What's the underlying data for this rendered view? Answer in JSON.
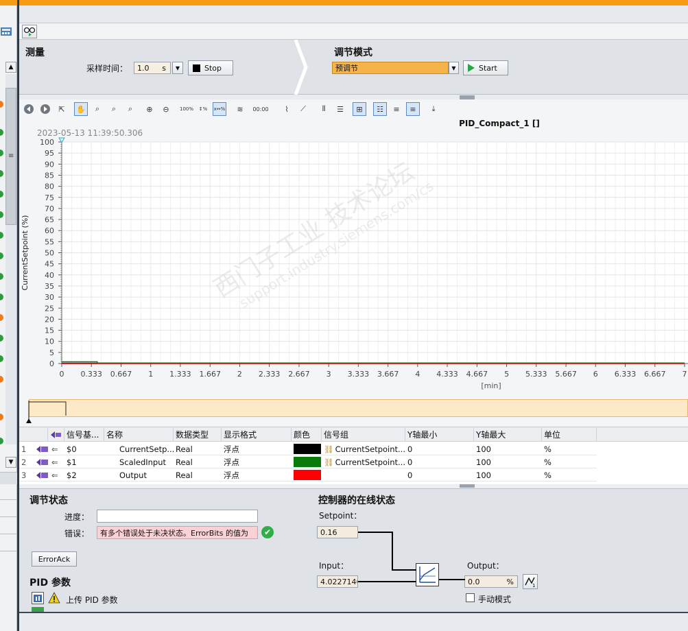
{
  "measurement": {
    "title": "测量",
    "sample_time_label": "采样时间：",
    "sample_time_value": "1.0",
    "sample_time_unit": "s",
    "stop_label": "Stop"
  },
  "tuning_mode": {
    "title": "调节模式",
    "selected": "预调节",
    "start_label": "Start"
  },
  "chart": {
    "title": "PID_Compact_1 []",
    "timestamp": "2023-05-13 11:39:50.306"
  },
  "chart_data": {
    "type": "line",
    "title": "PID_Compact_1 []",
    "ylabel": "CurrentSetpoint (%)",
    "xlabel": "[min]",
    "ylim": [
      0,
      100
    ],
    "xlim": [
      0,
      7
    ],
    "y_ticks": [
      "100",
      "95",
      "90",
      "85",
      "80",
      "75",
      "70",
      "65",
      "60",
      "55",
      "50",
      "45",
      "40",
      "35",
      "30",
      "25",
      "20",
      "15",
      "10",
      "5",
      "0"
    ],
    "x_ticks": [
      "0",
      "0.333",
      "0.667",
      "1",
      "1.333",
      "1.667",
      "2",
      "2.333",
      "2.667",
      "3",
      "3.333",
      "3.667",
      "4",
      "4.333",
      "4.667",
      "5",
      "5.333",
      "5.667",
      "6",
      "6.333",
      "6.667",
      "7"
    ],
    "grid": true,
    "series": [
      {
        "name": "CurrentSetpoint",
        "color": "#000000",
        "x": [
          0,
          7
        ],
        "y": [
          0.16,
          0.16
        ]
      },
      {
        "name": "ScaledInput",
        "color": "#0a7a0a",
        "x": [
          0,
          0.4,
          0.4,
          7
        ],
        "y": [
          0.8,
          0.8,
          0.2,
          0.2
        ]
      },
      {
        "name": "Output",
        "color": "#e00000",
        "x": [
          0,
          7
        ],
        "y": [
          0,
          0
        ]
      }
    ]
  },
  "signals": {
    "headers": [
      "信号基...",
      "名称",
      "数据类型",
      "显示格式",
      "颜色",
      "信号组",
      "Y轴最小",
      "Y轴最大",
      "单位"
    ],
    "rows": [
      {
        "idx": "1",
        "base": "$0",
        "name": "CurrentSetp...",
        "type": "Real",
        "format": "浮点",
        "color": "#000000",
        "group": "CurrentSetpoint...",
        "ymin": "0",
        "ymax": "100",
        "unit": "%"
      },
      {
        "idx": "2",
        "base": "$1",
        "name": "ScaledInput",
        "type": "Real",
        "format": "浮点",
        "color": "#0a7a0a",
        "group": "CurrentSetpoint...",
        "ymin": "0",
        "ymax": "100",
        "unit": "%"
      },
      {
        "idx": "3",
        "base": "$2",
        "name": "Output",
        "type": "Real",
        "format": "浮点",
        "color": "#ff0000",
        "group": "",
        "ymin": "0",
        "ymax": "100",
        "unit": "%"
      }
    ]
  },
  "tuning_status": {
    "title": "调节状态",
    "progress_label": "进度：",
    "progress_value": "",
    "error_label": "错误：",
    "error_value": "有多个错误处于未决状态。ErrorBits 的值为",
    "erroract_label": "ErrorAck"
  },
  "pid_params": {
    "title": "PID 参数",
    "upload_label": "上传 PID 参数"
  },
  "online_status": {
    "title": "控制器的在线状态",
    "setpoint_label": "Setpoint：",
    "setpoint_value": "0.16",
    "input_label": "Input：",
    "input_value": "4.0227146",
    "output_label": "Output：",
    "output_value": "0.0",
    "output_unit": "%",
    "manual_label": "手动模式"
  },
  "watermark": {
    "line1": "西门子工业 技术论坛",
    "line2": "support.industry.siemens.com/cs"
  }
}
